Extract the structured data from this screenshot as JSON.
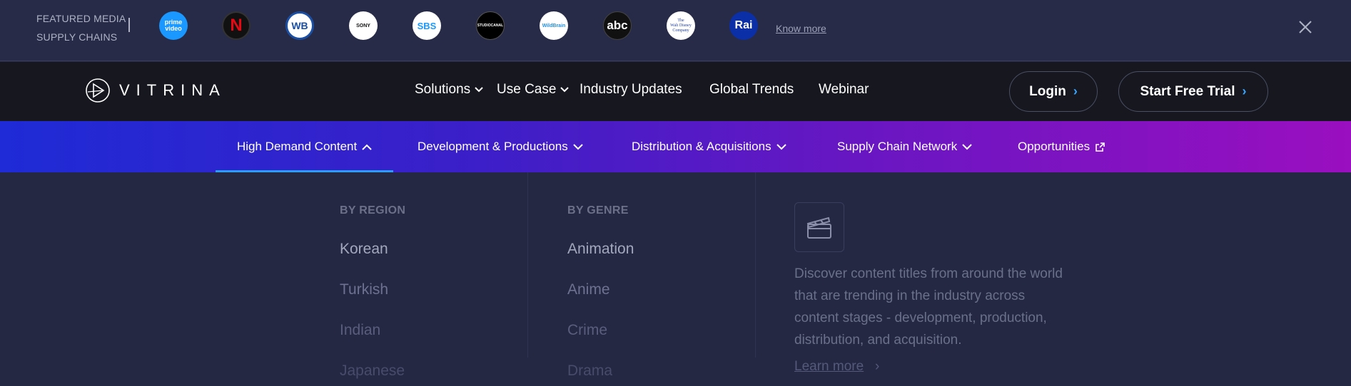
{
  "featured": {
    "label_line1": "FEATURED MEDIA",
    "label_line2": "SUPPLY CHAINS",
    "logos": [
      {
        "name": "prime video",
        "text_top": "prime",
        "text_bottom": "video",
        "bg": "#1a98ff",
        "fg": "#ffffff"
      },
      {
        "name": "netflix",
        "text": "N",
        "bg": "#111111",
        "fg": "#e50914"
      },
      {
        "name": "warner bros",
        "text": "WB",
        "bg": "#ffffff",
        "fg": "#1b4fa3"
      },
      {
        "name": "sony",
        "text": "SONY",
        "bg": "#ffffff",
        "fg": "#111111"
      },
      {
        "name": "sbs",
        "text": "SBS",
        "bg": "#ffffff",
        "fg": "#1a98ff"
      },
      {
        "name": "studiocanal",
        "text": "STUDIOCANAL",
        "bg": "#000000",
        "fg": "#ffffff"
      },
      {
        "name": "wildbrain",
        "text": "WildBrain",
        "bg": "#ffffff",
        "fg": "#2b8fd6"
      },
      {
        "name": "abc",
        "text": "abc",
        "bg": "#111111",
        "fg": "#ffffff"
      },
      {
        "name": "disney",
        "text_top": "The",
        "text_mid": "Walt Disney",
        "text_bottom": "Company",
        "bg": "#ffffff",
        "fg": "#1f3f9c"
      },
      {
        "name": "rai",
        "text": "Rai",
        "bg": "#0b2fa6",
        "fg": "#ffffff"
      }
    ],
    "know_more": "Know more"
  },
  "nav": {
    "brand": "VITRINA",
    "items": [
      "Solutions",
      "Use Case",
      "Industry Updates",
      "Global Trends",
      "Webinar"
    ],
    "login": "Login",
    "trial": "Start Free Trial",
    "accent": "#38a7ff"
  },
  "subnav": {
    "items": [
      "High Demand Content",
      "Development & Productions",
      "Distribution & Acquisitions",
      "Supply Chain Network",
      "Opportunities"
    ],
    "active_index": 0
  },
  "mega": {
    "region": {
      "heading": "BY REGION",
      "items": [
        "Korean",
        "Turkish",
        "Indian",
        "Japanese"
      ]
    },
    "genre": {
      "heading": "BY GENRE",
      "items": [
        "Animation",
        "Anime",
        "Crime",
        "Drama"
      ]
    },
    "description": "Discover content titles from around the world that are trending in the industry across content stages - development, production, distribution, and acquisition.",
    "learn_more": "Learn more"
  }
}
